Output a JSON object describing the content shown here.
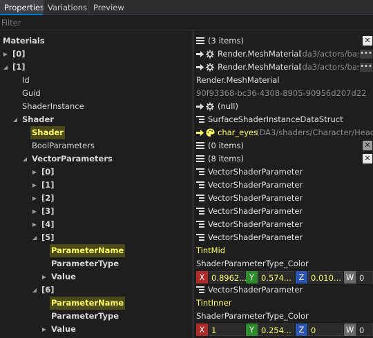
{
  "tabs": [
    {
      "label": "Properties"
    },
    {
      "label": "Variations"
    },
    {
      "label": "Preview"
    }
  ],
  "filter": {
    "placeholder": "Filter"
  },
  "tree": {
    "materials": "Materials",
    "idx0": "[0]",
    "idx1": "[1]",
    "id": "Id",
    "guid": "Guid",
    "shaderinstance": "ShaderInstance",
    "shader_group": "Shader",
    "shader": "Shader",
    "boolparameters": "BoolParameters",
    "vectorparameters": "VectorParameters",
    "v0": "[0]",
    "v1": "[1]",
    "v2": "[2]",
    "v3": "[3]",
    "v4": "[4]",
    "v5": "[5]",
    "v5_paramname": "ParameterName",
    "v5_paramtype": "ParameterType",
    "v5_value": "Value",
    "v6": "[6]",
    "v6_paramname": "ParameterName",
    "v6_paramtype": "ParameterType",
    "v6_value": "Value"
  },
  "values": {
    "materials": "(3 items)",
    "idx0_type": "Render.MeshMaterial",
    "idx0_path": "(da3/actors/bas...",
    "idx1_type": "Render.MeshMaterial",
    "idx1_path": "(da3/actors/bas...",
    "id": "Render.MeshMaterial",
    "guid": "90f93368-bc36-4308-8905-90956d207d22",
    "shaderinstance": "(null)",
    "shader_group": "SurfaceShaderInstanceDataStruct",
    "shader_name": "char_eyes",
    "shader_path": "(DA3/shaders/Character/Head...",
    "boolparameters": "(0 items)",
    "vectorparameters": "(8 items)",
    "vsp": "VectorShaderParameter",
    "v5_paramname": "TintMid",
    "v5_paramtype": "ShaderParameterType_Color",
    "v5_x": "0.8962...",
    "v5_y": "0.574...",
    "v5_z": "0.010...",
    "v5_w": "0",
    "v6_paramname": "TintInner",
    "v6_paramtype": "ShaderParameterType_Color",
    "v6_x": "1",
    "v6_y": "0.254...",
    "v6_z": "0",
    "v6_w": "0"
  },
  "axis": {
    "x": "X",
    "y": "Y",
    "z": "Z",
    "w": "W"
  },
  "buttons": {
    "remove": "✕",
    "more": "•••"
  }
}
